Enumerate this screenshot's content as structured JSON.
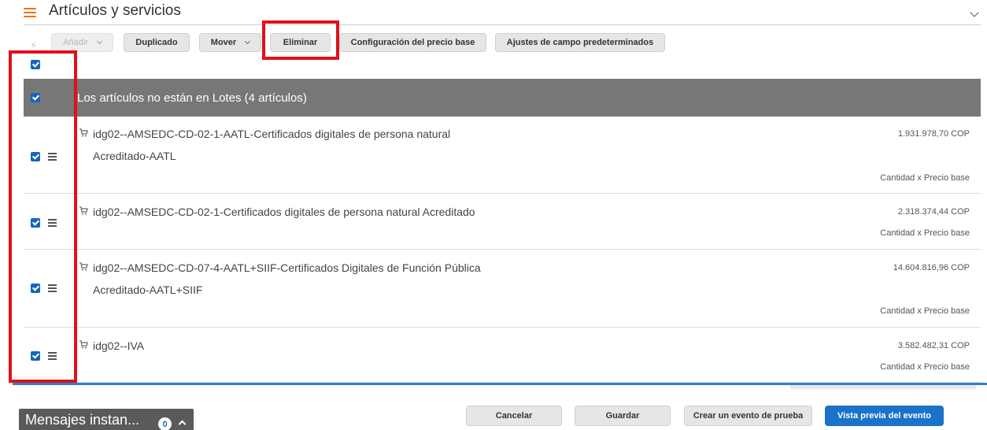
{
  "header": {
    "title": "Artículos y servicios"
  },
  "toolbar": {
    "add_label": "Añadir",
    "duplicate_label": "Duplicado",
    "move_label": "Mover",
    "delete_label": "Eliminar",
    "base_price_config_label": "Configuración del precio base",
    "default_field_settings_label": "Ajustes de campo predeterminados"
  },
  "lot": {
    "title": "Los artículos no están en Lotes (4 artículos)"
  },
  "items": [
    {
      "name_line1": "idg02--AMSEDC-CD-02-1-AATL-Certificados digitales de persona natural",
      "name_line2": "Acreditado-AATL",
      "price": "1.931.978,70 COP",
      "qty_label": "Cantidad x Precio base"
    },
    {
      "name_line1": "idg02--AMSEDC-CD-02-1-Certificados digitales de persona natural Acreditado",
      "name_line2": "",
      "price": "2.318.374,44 COP",
      "qty_label": "Cantidad x Precio base"
    },
    {
      "name_line1": "idg02--AMSEDC-CD-07-4-AATL+SIIF-Certificados Digitales de Función Pública",
      "name_line2": "Acreditado-AATL+SIIF",
      "price": "14.604.816,96 COP",
      "qty_label": "Cantidad x Precio base"
    },
    {
      "name_line1": "idg02--IVA",
      "name_line2": "",
      "price": "3.582.482,31 COP",
      "qty_label": "Cantidad x Precio base"
    }
  ],
  "footer": {
    "cancel_label": "Cancelar",
    "save_label": "Guardar",
    "test_event_label": "Crear un evento de prueba",
    "preview_label": "Vista previa del evento"
  },
  "instant_messages": {
    "label": "Mensajes instan...",
    "count": "0"
  },
  "colors": {
    "accent_orange": "#e8731a",
    "primary_blue": "#1a73c9",
    "checkbox_blue": "#1366bd",
    "annotation_red": "#e0101b",
    "lot_bar_gray": "#777777"
  },
  "icons": [
    "list-icon",
    "chevron-down-icon",
    "lightning-icon",
    "checkbox-checked-icon",
    "drag-handle-icon",
    "cart-icon",
    "chevron-up-icon"
  ]
}
